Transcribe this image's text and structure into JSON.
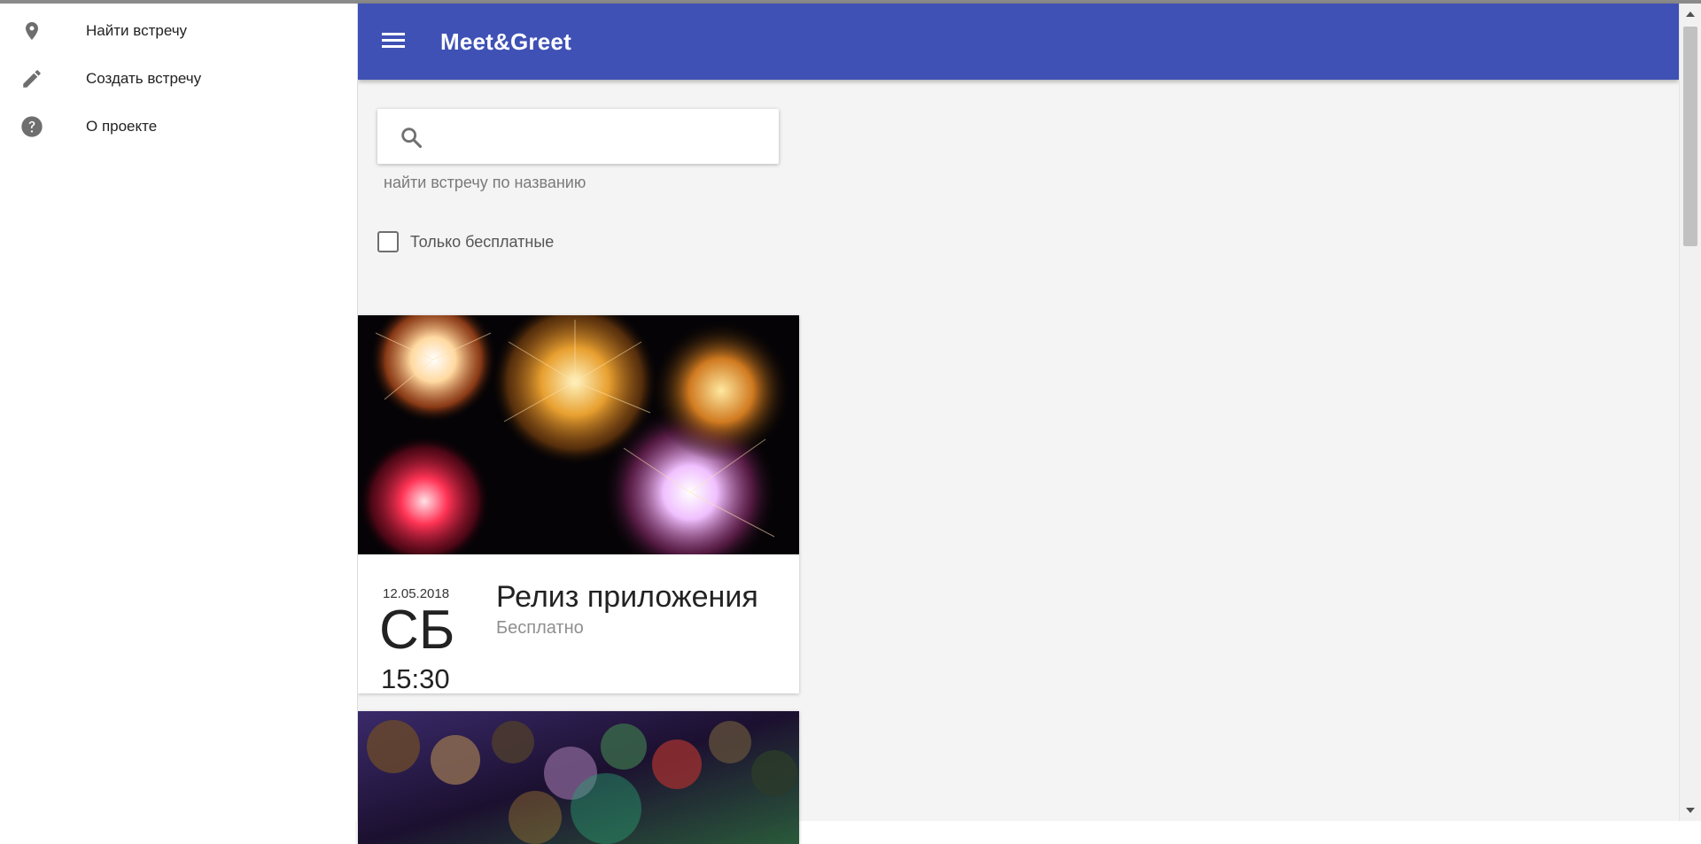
{
  "sidebar": {
    "items": [
      {
        "label": "Найти встречу",
        "icon": "location-pin-icon"
      },
      {
        "label": "Создать встречу",
        "icon": "pencil-icon"
      },
      {
        "label": "О проекте",
        "icon": "help-icon"
      }
    ]
  },
  "appbar": {
    "title": "Meet&Greet",
    "menu_icon": "hamburger-menu-icon"
  },
  "search": {
    "value": "",
    "placeholder": "",
    "hint": "найти встречу по названию",
    "icon": "search-icon"
  },
  "filters": {
    "free_only_label": "Только бесплатные",
    "free_only_checked": false
  },
  "events": [
    {
      "date": "12.05.2018",
      "weekday": "СБ",
      "time": "15:30",
      "title": "Релиз приложения",
      "price": "Бесплатно",
      "image": "fireworks-image"
    },
    {
      "image": "superheroes-poster-image"
    }
  ],
  "colors": {
    "primary": "#3f51b5",
    "background": "#f4f4f4",
    "icon_gray": "#6e6e6e"
  }
}
